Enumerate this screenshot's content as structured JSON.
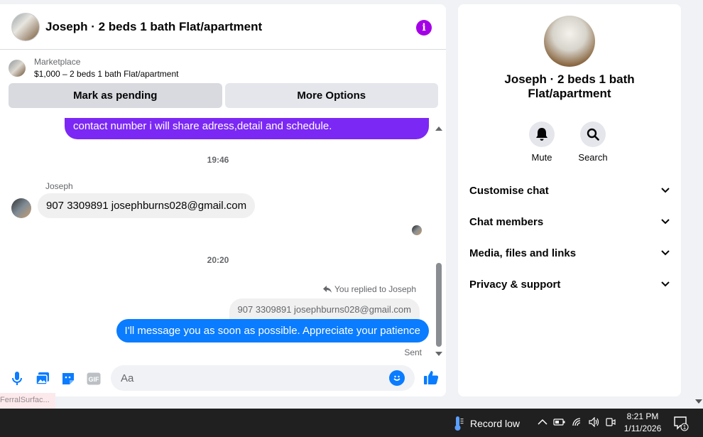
{
  "header": {
    "title": "Joseph · 2 beds 1 bath Flat/apartment"
  },
  "marketplace": {
    "label": "Marketplace",
    "price_line": "$1,000 – 2 beds 1 bath Flat/apartment",
    "pending_button": "Mark as pending",
    "more_button": "More Options"
  },
  "messages": {
    "outgoing_partial": "contact number i will share adress,detail and schedule.",
    "time1": "19:46",
    "sender": "Joseph",
    "incoming": "907 3309891 josephburns028@gmail.com",
    "time2": "20:20",
    "replied_label": "You replied to Joseph",
    "quoted": "907 3309891 josephburns028@gmail.com",
    "outgoing": "I'll message you as soon as possible. Appreciate your patience",
    "status": "Sent"
  },
  "composer": {
    "placeholder": "Aa",
    "gif_label": "GIF"
  },
  "ferral_label": "FerralSurfac...",
  "side": {
    "title": "Joseph · 2 beds 1 bath Flat/apartment",
    "mute_label": "Mute",
    "search_label": "Search",
    "items": [
      {
        "label": "Customise chat"
      },
      {
        "label": "Chat members"
      },
      {
        "label": "Media, files and links"
      },
      {
        "label": "Privacy & support"
      }
    ]
  },
  "taskbar": {
    "weather": "Record low",
    "time": "8:21 PM",
    "date": "1/11/2026",
    "notif_count": "1"
  },
  "colors": {
    "accent_purple": "#7b28f5",
    "accent_blue": "#0a7cff",
    "info_icon": "#a400e8"
  }
}
